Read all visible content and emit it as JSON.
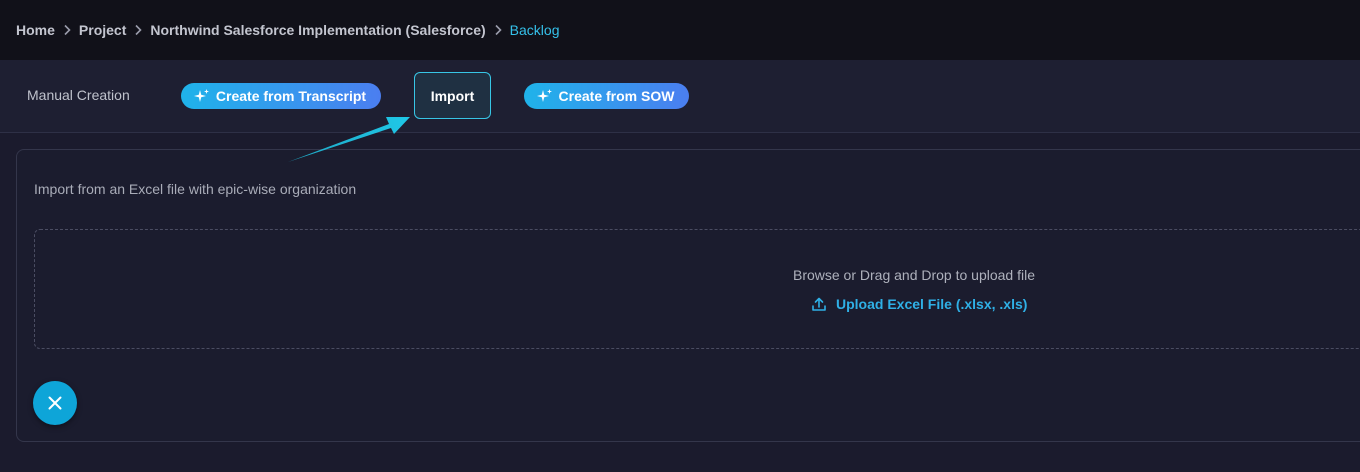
{
  "breadcrumb": {
    "items": [
      "Home",
      "Project",
      "Northwind Salesforce Implementation (Salesforce)"
    ],
    "current": "Backlog"
  },
  "tabs": {
    "manual": "Manual Creation",
    "transcript": "Create from Transcript",
    "import": "Import",
    "sow": "Create from SOW"
  },
  "import_panel": {
    "description": "Import from an Excel file with epic-wise organization",
    "drop_text": "Browse or Drag and Drop to upload file",
    "upload_label": "Upload Excel File (.xlsx, .xls)"
  },
  "icons": {
    "sparkle": "sparkle-icon",
    "upload": "upload-icon",
    "close": "close-icon",
    "chevron": "chevron-right-icon"
  },
  "colors": {
    "accent": "#35c1ea",
    "gradient_start": "#1fb3ea",
    "gradient_end": "#4b7ef0",
    "fab": "#0ea5d8",
    "annotation_arrow": "#1fc8e8"
  }
}
